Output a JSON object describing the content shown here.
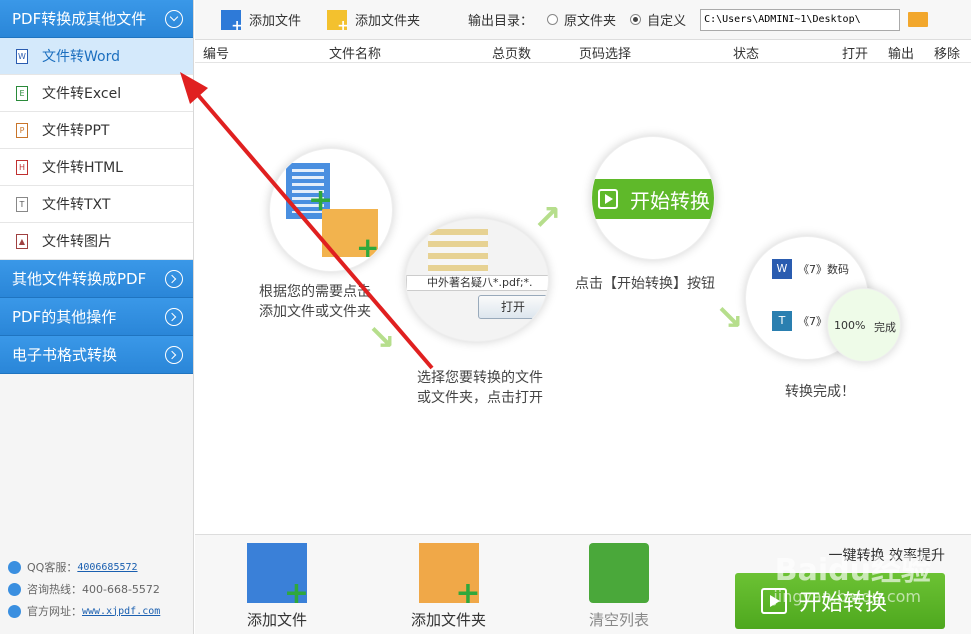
{
  "sidebar": {
    "groups": [
      {
        "label": "PDF转换成其他文件",
        "expanded": true
      },
      {
        "label": "其他文件转换成PDF"
      },
      {
        "label": "PDF的其他操作"
      },
      {
        "label": "电子书格式转换"
      }
    ],
    "items": [
      {
        "label": "文件转Word",
        "icon": "W"
      },
      {
        "label": "文件转Excel",
        "icon": "E"
      },
      {
        "label": "文件转PPT",
        "icon": "P"
      },
      {
        "label": "文件转HTML",
        "icon": "H"
      },
      {
        "label": "文件转TXT",
        "icon": "T"
      },
      {
        "label": "文件转图片",
        "icon": "▲"
      }
    ],
    "contact": {
      "qq_label": "QQ客服：",
      "qq_value": "4006685572",
      "hotline_label": "咨询热线：",
      "hotline_value": "400-668-5572",
      "site_label": "官方网址：",
      "site_value": "www.xjpdf.com"
    }
  },
  "toolbar": {
    "add_file": "添加文件",
    "add_folder": "添加文件夹",
    "output_dir_label": "输出目录：",
    "option_original": "原文件夹",
    "option_custom": "自定义",
    "path_value": "C:\\Users\\ADMINI~1\\Desktop\\"
  },
  "table": {
    "headers": [
      "编号",
      "文件名称",
      "总页数",
      "页码选择",
      "状态",
      "打开",
      "输出",
      "移除"
    ]
  },
  "illustration": {
    "step1_text": [
      "根据您的需要点击",
      "添加文件或文件夹"
    ],
    "step2_text": [
      "选择您要转换的文件",
      "或文件夹，点击打开"
    ],
    "step2_filename": "中外著名疑八*.pdf;*.",
    "step2_open_button": "打开",
    "step3_button": "开始转换",
    "step3_text": "点击【开始转换】按钮",
    "step4_item1": "《7》数码",
    "step4_item2": "《7》",
    "step4_progress": "100%",
    "step4_done_label": "完成",
    "step4_text": "转换完成！"
  },
  "bottom": {
    "add_file": "添加文件",
    "add_folder": "添加文件夹",
    "clear_list": "清空列表",
    "efficiency_text": "一键转换 效率提升",
    "start_button": "开始转换"
  },
  "watermark": {
    "brand": "Baidu经验",
    "url": "jingyan.baidu.com"
  },
  "colors": {
    "sidebar_blue": "#2a86d8",
    "active_item": "#d4e9fb",
    "start_green": "#5fb92a",
    "annotation_arrow": "#e02020"
  }
}
